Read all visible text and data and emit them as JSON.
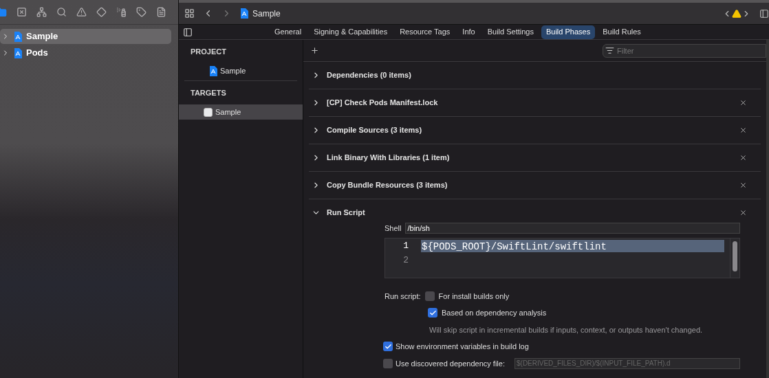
{
  "navigator": {
    "items": [
      {
        "label": "Sample",
        "selected": true,
        "expanded": false
      },
      {
        "label": "Pods",
        "selected": false,
        "expanded": false
      }
    ]
  },
  "editor": {
    "breadcrumb": "Sample",
    "tabs": [
      {
        "label": "General",
        "selected": false
      },
      {
        "label": "Signing & Capabilities",
        "selected": false
      },
      {
        "label": "Resource Tags",
        "selected": false
      },
      {
        "label": "Info",
        "selected": false
      },
      {
        "label": "Build Settings",
        "selected": false
      },
      {
        "label": "Build Phases",
        "selected": true
      },
      {
        "label": "Build Rules",
        "selected": false
      }
    ],
    "targets_panel": {
      "sections": [
        {
          "title": "PROJECT",
          "items": [
            {
              "label": "Sample",
              "kind": "project",
              "selected": false
            }
          ]
        },
        {
          "title": "TARGETS",
          "items": [
            {
              "label": "Sample",
              "kind": "target",
              "selected": true
            }
          ]
        }
      ]
    },
    "filter": {
      "placeholder": "Filter"
    },
    "phases": [
      {
        "title": "Dependencies (0 items)",
        "expanded": false,
        "removable": false
      },
      {
        "title": "[CP] Check Pods Manifest.lock",
        "expanded": false,
        "removable": true
      },
      {
        "title": "Compile Sources (3 items)",
        "expanded": false,
        "removable": true
      },
      {
        "title": "Link Binary With Libraries (1 item)",
        "expanded": false,
        "removable": true
      },
      {
        "title": "Copy Bundle Resources (3 items)",
        "expanded": false,
        "removable": true
      },
      {
        "title": "Run Script",
        "expanded": true,
        "removable": true
      }
    ],
    "run_script": {
      "shell_label": "Shell",
      "shell_value": "/bin/sh",
      "lines": [
        {
          "number": "1",
          "text": "${PODS_ROOT}/SwiftLint/swiftlint",
          "selected": true
        },
        {
          "number": "2",
          "selected": false
        }
      ],
      "run_script_label": "Run script:",
      "options": [
        {
          "label": "For install builds only",
          "checked": false
        },
        {
          "label": "Based on dependency analysis",
          "checked": true
        }
      ],
      "note": "Will skip script in incremental builds if inputs, context, or outputs haven't changed.",
      "show_env": {
        "label": "Show environment variables in build log",
        "checked": true
      },
      "dep_file": {
        "label": "Use discovered dependency file:",
        "checked": false,
        "placeholder": "$(DERIVED_FILES_DIR)/$(INPUT_FILE_PATH).d"
      }
    }
  }
}
